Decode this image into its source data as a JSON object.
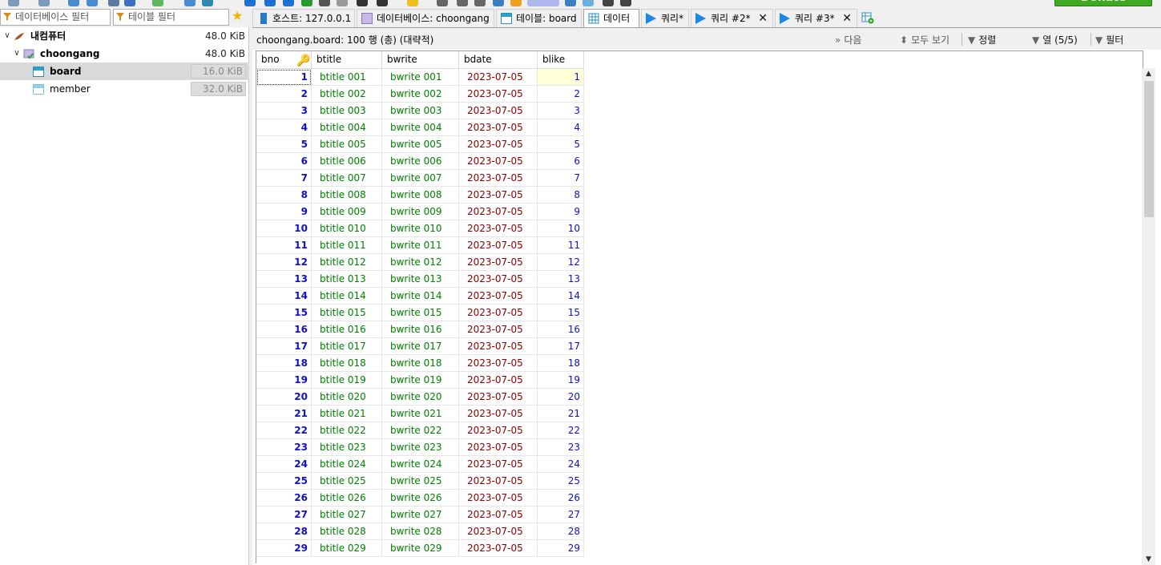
{
  "toolbar": {
    "donate_label": "Donate"
  },
  "filters": {
    "database_filter_placeholder": "데이터베이스 필터",
    "table_filter_placeholder": "테이블 필터"
  },
  "tree": {
    "root": {
      "label": "내컴퓨터",
      "size": "48.0 KiB"
    },
    "database": {
      "label": "choongang",
      "size": "48.0 KiB"
    },
    "tables": [
      {
        "label": "board",
        "size": "16.0 KiB"
      },
      {
        "label": "member",
        "size": "32.0 KiB"
      }
    ]
  },
  "tabs": [
    {
      "label": "호스트: 127.0.0.1"
    },
    {
      "label": "데이터베이스: choongang"
    },
    {
      "label": "테이블: board"
    },
    {
      "label": "데이터"
    },
    {
      "label": "쿼리*"
    },
    {
      "label": "쿼리 #2*"
    },
    {
      "label": "쿼리 #3*"
    }
  ],
  "info": {
    "title": "choongang.board: 100 행 (총) (대략적)",
    "next_label": "다음",
    "show_all_label": "모두 보기",
    "sort_label": "정렬",
    "columns_label": "열 (5/5)",
    "filter_label": "필터"
  },
  "columns": [
    "bno",
    "btitle",
    "bwrite",
    "bdate",
    "blike"
  ],
  "rows": [
    {
      "bno": "1",
      "btitle": "btitle 001",
      "bwrite": "bwrite 001",
      "bdate": "2023-07-05",
      "blike": "1"
    },
    {
      "bno": "2",
      "btitle": "btitle 002",
      "bwrite": "bwrite 002",
      "bdate": "2023-07-05",
      "blike": "2"
    },
    {
      "bno": "3",
      "btitle": "btitle 003",
      "bwrite": "bwrite 003",
      "bdate": "2023-07-05",
      "blike": "3"
    },
    {
      "bno": "4",
      "btitle": "btitle 004",
      "bwrite": "bwrite 004",
      "bdate": "2023-07-05",
      "blike": "4"
    },
    {
      "bno": "5",
      "btitle": "btitle 005",
      "bwrite": "bwrite 005",
      "bdate": "2023-07-05",
      "blike": "5"
    },
    {
      "bno": "6",
      "btitle": "btitle 006",
      "bwrite": "bwrite 006",
      "bdate": "2023-07-05",
      "blike": "6"
    },
    {
      "bno": "7",
      "btitle": "btitle 007",
      "bwrite": "bwrite 007",
      "bdate": "2023-07-05",
      "blike": "7"
    },
    {
      "bno": "8",
      "btitle": "btitle 008",
      "bwrite": "bwrite 008",
      "bdate": "2023-07-05",
      "blike": "8"
    },
    {
      "bno": "9",
      "btitle": "btitle 009",
      "bwrite": "bwrite 009",
      "bdate": "2023-07-05",
      "blike": "9"
    },
    {
      "bno": "10",
      "btitle": "btitle 010",
      "bwrite": "bwrite 010",
      "bdate": "2023-07-05",
      "blike": "10"
    },
    {
      "bno": "11",
      "btitle": "btitle 011",
      "bwrite": "bwrite 011",
      "bdate": "2023-07-05",
      "blike": "11"
    },
    {
      "bno": "12",
      "btitle": "btitle 012",
      "bwrite": "bwrite 012",
      "bdate": "2023-07-05",
      "blike": "12"
    },
    {
      "bno": "13",
      "btitle": "btitle 013",
      "bwrite": "bwrite 013",
      "bdate": "2023-07-05",
      "blike": "13"
    },
    {
      "bno": "14",
      "btitle": "btitle 014",
      "bwrite": "bwrite 014",
      "bdate": "2023-07-05",
      "blike": "14"
    },
    {
      "bno": "15",
      "btitle": "btitle 015",
      "bwrite": "bwrite 015",
      "bdate": "2023-07-05",
      "blike": "15"
    },
    {
      "bno": "16",
      "btitle": "btitle 016",
      "bwrite": "bwrite 016",
      "bdate": "2023-07-05",
      "blike": "16"
    },
    {
      "bno": "17",
      "btitle": "btitle 017",
      "bwrite": "bwrite 017",
      "bdate": "2023-07-05",
      "blike": "17"
    },
    {
      "bno": "18",
      "btitle": "btitle 018",
      "bwrite": "bwrite 018",
      "bdate": "2023-07-05",
      "blike": "18"
    },
    {
      "bno": "19",
      "btitle": "btitle 019",
      "bwrite": "bwrite 019",
      "bdate": "2023-07-05",
      "blike": "19"
    },
    {
      "bno": "20",
      "btitle": "btitle 020",
      "bwrite": "bwrite 020",
      "bdate": "2023-07-05",
      "blike": "20"
    },
    {
      "bno": "21",
      "btitle": "btitle 021",
      "bwrite": "bwrite 021",
      "bdate": "2023-07-05",
      "blike": "21"
    },
    {
      "bno": "22",
      "btitle": "btitle 022",
      "bwrite": "bwrite 022",
      "bdate": "2023-07-05",
      "blike": "22"
    },
    {
      "bno": "23",
      "btitle": "btitle 023",
      "bwrite": "bwrite 023",
      "bdate": "2023-07-05",
      "blike": "23"
    },
    {
      "bno": "24",
      "btitle": "btitle 024",
      "bwrite": "bwrite 024",
      "bdate": "2023-07-05",
      "blike": "24"
    },
    {
      "bno": "25",
      "btitle": "btitle 025",
      "bwrite": "bwrite 025",
      "bdate": "2023-07-05",
      "blike": "25"
    },
    {
      "bno": "26",
      "btitle": "btitle 026",
      "bwrite": "bwrite 026",
      "bdate": "2023-07-05",
      "blike": "26"
    },
    {
      "bno": "27",
      "btitle": "btitle 027",
      "bwrite": "bwrite 027",
      "bdate": "2023-07-05",
      "blike": "27"
    },
    {
      "bno": "28",
      "btitle": "btitle 028",
      "bwrite": "bwrite 028",
      "bdate": "2023-07-05",
      "blike": "28"
    },
    {
      "bno": "29",
      "btitle": "btitle 029",
      "bwrite": "bwrite 029",
      "bdate": "2023-07-05",
      "blike": "29"
    }
  ]
}
